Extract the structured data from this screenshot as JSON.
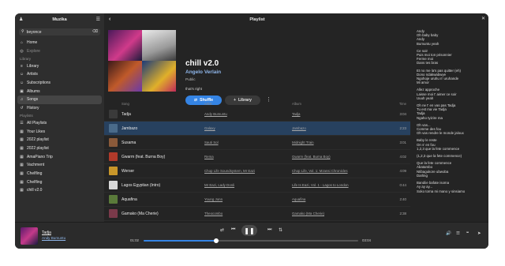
{
  "sidebar": {
    "title": "Muzika",
    "search_value": "beyonce",
    "items": [
      {
        "label": "Home",
        "icon": "home-icon",
        "kind": "item"
      },
      {
        "label": "Explore",
        "icon": "compass-icon",
        "kind": "dim"
      },
      {
        "label": "Library",
        "icon": "",
        "kind": "section"
      },
      {
        "label": "Library",
        "icon": "library-icon",
        "kind": "item"
      },
      {
        "label": "Artists",
        "icon": "person-icon",
        "kind": "item"
      },
      {
        "label": "Subscriptions",
        "icon": "person-icon",
        "kind": "item"
      },
      {
        "label": "Albums",
        "icon": "album-icon",
        "kind": "item"
      },
      {
        "label": "Songs",
        "icon": "music-note-icon",
        "kind": "selected"
      },
      {
        "label": "History",
        "icon": "history-icon",
        "kind": "item"
      },
      {
        "label": "Playlists",
        "icon": "",
        "kind": "section"
      },
      {
        "label": "All Playlists",
        "icon": "playlist-icon",
        "kind": "item"
      },
      {
        "label": "Your Likes",
        "icon": "grid-icon",
        "kind": "item"
      },
      {
        "label": "2022 playlist",
        "icon": "grid-icon",
        "kind": "item"
      },
      {
        "label": "2022 playlist",
        "icon": "grid-icon",
        "kind": "item"
      },
      {
        "label": "AmaPiano Trip",
        "icon": "grid-icon",
        "kind": "item"
      },
      {
        "label": "Vachment",
        "icon": "grid-icon",
        "kind": "item"
      },
      {
        "label": "Chelfling",
        "icon": "grid-icon",
        "kind": "item"
      },
      {
        "label": "Chelfling",
        "icon": "grid-icon",
        "kind": "item"
      },
      {
        "label": "chill v2.0",
        "icon": "grid-icon",
        "kind": "item"
      }
    ]
  },
  "main": {
    "header_title": "Playlist",
    "playlist": {
      "title": "chill v2.0",
      "artist": "Angelo Verlain",
      "visibility": "Public",
      "description": "that's right",
      "shuffle_label": "Shuffle",
      "library_label": "Library"
    },
    "columns": {
      "song": "Song",
      "artist": "Artist",
      "album": "Album",
      "time": "Time"
    },
    "rows": [
      {
        "title": "Tadja",
        "artist": "Andy Bumuntu",
        "album": "Tadja",
        "time": "3:04",
        "thumb": "#3a3a3a",
        "selected": false
      },
      {
        "title": "Jambazo",
        "artist": "Galaxy",
        "album": "Jambazo",
        "time": "2:23",
        "thumb": "#4a6b8a",
        "selected": true
      },
      {
        "title": "Susama",
        "artist": "Sauti Sol",
        "album": "Midnight Train",
        "time": "3:01",
        "thumb": "#8a5a3a",
        "selected": false
      },
      {
        "title": "Gwarm (feat. Burna Boy)",
        "artist": "Rema",
        "album": "Gwarm (feat. Burna Boy)",
        "time": "4:02",
        "thumb": "#b03a2a",
        "selected": false
      },
      {
        "title": "Werser",
        "artist": "Chop Life Soundsystem, Mr Eazi",
        "album": "Chop Life, Vol. 1: Mzansi Chronicles",
        "time": "4:09",
        "thumb": "#c8962a",
        "selected": false
      },
      {
        "title": "Lagos Egyptian (Intro)",
        "artist": "Mr Eazi, Lady Donli",
        "album": "Life Is Eazi, Vol. 1 - Lagos to London",
        "time": "0:44",
        "thumb": "#d8d8d8",
        "selected": false
      },
      {
        "title": "Aquafina",
        "artist": "Young Jonn",
        "album": "Aquafina",
        "time": "2:40",
        "thumb": "#5a7a3a",
        "selected": false
      },
      {
        "title": "Gamako (Ma Cherie)",
        "artist": "Theocombo",
        "album": "Gamako (Ma Cherie)",
        "time": "2:38",
        "thumb": "#7a3a4a",
        "selected": false
      }
    ]
  },
  "lyrics": [
    [
      "Andy",
      "Oh baby baby",
      "Andy",
      "Bumuntu yeah"
    ],
    [
      "Ce soir",
      "Puis moi ton prisonnier",
      "Ferme moi",
      "Dans tes bras"
    ],
    [
      "Et no me la's pas quitter (eh)",
      "Dono ndakwabwye",
      "Ngohoje uruhu n' uruhande",
      "Mi amor"
    ],
    [
      "Allez approche",
      "Laisse moi t' aimer ce soir",
      "Uuuh yeah"
    ],
    [
      "Oh ne t' en vas pas Tadja",
      "Tu est ma vie Tadja",
      "Tadja",
      "Ngaho tyizire ma"
    ],
    [
      "Oh vas...",
      "Comme des fou",
      "Oh vas rendre le monde jaloux"
    ],
    [
      "Baby le reste",
      "On s' en fou",
      "1,2,3 que la fete commence"
    ],
    [
      "(1,2,3 que la fete commence)"
    ],
    [
      "Que la fete commence",
      "Abatambo",
      "Ntibagukore ubwoba",
      "Darling"
    ],
    [
      "Bandiie bafate isoma",
      "Ay ay ay...",
      "Soko torna mi mano y sinsiamo"
    ]
  ],
  "player": {
    "title": "Tadja",
    "artist": "Andy Bumuntu",
    "elapsed": "01:02",
    "total": "03:04",
    "progress_fraction": 0.337
  },
  "colors": {
    "accent": "#3584e4",
    "link": "#8fb6ea"
  }
}
